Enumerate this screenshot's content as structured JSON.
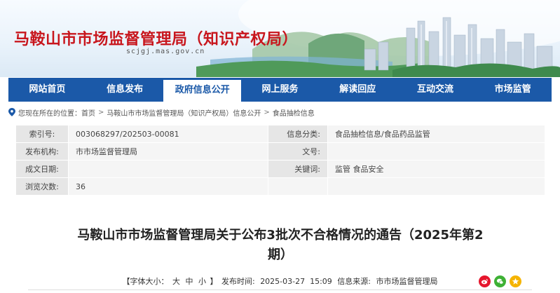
{
  "site": {
    "title": "马鞍山市市场监督管理局（知识产权局）",
    "domain": "scjgj.mas.gov.cn"
  },
  "nav": {
    "items": [
      {
        "label": "网站首页",
        "active": false
      },
      {
        "label": "信息发布",
        "active": false
      },
      {
        "label": "政府信息公开",
        "active": true
      },
      {
        "label": "网上服务",
        "active": false
      },
      {
        "label": "解读回应",
        "active": false
      },
      {
        "label": "互动交流",
        "active": false
      },
      {
        "label": "市场监管",
        "active": false
      }
    ]
  },
  "breadcrumb": {
    "prefix": "您现在所在的位置：",
    "items": [
      "首页",
      "马鞍山市市场监督管理局（知识产权局）信息公开",
      "食品抽检信息"
    ],
    "separator": ">"
  },
  "info": {
    "index_label": "索引号:",
    "index_value": "003068297/202503-00081",
    "category_label": "信息分类:",
    "category_value": "食品抽检信息/食品药品监管",
    "org_label": "发布机构:",
    "org_value": "市市场监督管理局",
    "docno_label": "文号:",
    "docno_value": "",
    "date_label": "成文日期:",
    "date_value": "",
    "keywords_label": "关键词:",
    "keywords_value": "监管 食品安全",
    "views_label": "浏览次数:",
    "views_value": "36"
  },
  "article": {
    "title": "马鞍山市市场监督管理局关于公布3批次不合格情况的通告（2025年第2期）",
    "font_size_prefix": "【字体大小：",
    "font_size_large": "大",
    "font_size_medium": "中",
    "font_size_small": "小",
    "font_size_suffix": "】",
    "publish_label": "发布时间:",
    "publish_time": "2025-03-27  15:09",
    "source_label": "信息来源:",
    "source_value": "市市场监督管理局"
  },
  "share": {
    "icons": [
      "weibo-icon",
      "wechat-icon",
      "qzone-icon"
    ],
    "colors": {
      "weibo": "#e6162d",
      "wechat": "#3eb135",
      "qzone": "#f5b400"
    }
  },
  "colors": {
    "nav_bg": "#1b59a8",
    "title_red": "#c8161d"
  }
}
